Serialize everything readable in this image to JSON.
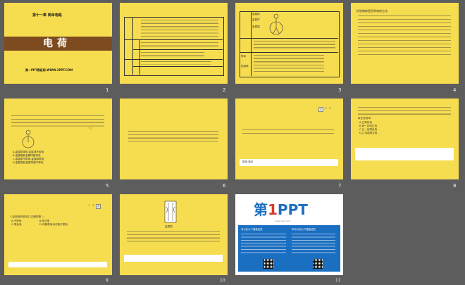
{
  "slides": [
    {
      "num": "1",
      "chapter": "第十一章 简单电路",
      "title": "电荷",
      "site": "第一PPT模板网-WWW.1PPT.COM"
    },
    {
      "num": "2"
    },
    {
      "num": "3",
      "labels": {
        "metal_ball": "金属球",
        "metal_rod": "金属杆",
        "metal_foil": "金属箔",
        "conductor": "导体",
        "insulator": "绝缘体"
      }
    },
    {
      "num": "4",
      "title": "检验物体是否带电的方法"
    },
    {
      "num": "5",
      "answers": [
        "A.金属箔带电,金属球不带电",
        "B.金属箔和金属球都带电",
        "C.金属箔不带电,金属球带电",
        "D.金属箔和金属球都不带电"
      ],
      "bracket": "(  )"
    },
    {
      "num": "6"
    },
    {
      "num": "7",
      "pages": [
        "1",
        "2",
        "3"
      ],
      "answer": "带电 吸引"
    },
    {
      "num": "8",
      "options": [
        "A.乙带负电",
        "B.丙一定带正电",
        "C.乙一定带负电",
        "D.乙可能带正电"
      ],
      "lead": "带正电的甲:"
    },
    {
      "num": "9",
      "pages": [
        "1",
        "2",
        "3"
      ],
      "q": "1.给电荷的说法中,正确的是 (  )",
      "options": [
        "A.不带电",
        "B.带正电",
        "C.带负电",
        "D.可能带电也可能不带电"
      ]
    },
    {
      "num": "10",
      "figure_caption": "金属箔"
    },
    {
      "num": "11",
      "logo": {
        "text_a": "第",
        "text_1": "1",
        "text_b": "PPT"
      },
      "site_url": "www.1ppt.com",
      "left_title": "可以在以下搜索这些",
      "right_title": "本可以在以下搜索这些"
    }
  ],
  "colors": {
    "slide_bg": "#f6dc4f",
    "workspace_bg": "#5d5d5d",
    "bar": "#7d4b1f",
    "logo_blue": "#1b6fc1"
  }
}
